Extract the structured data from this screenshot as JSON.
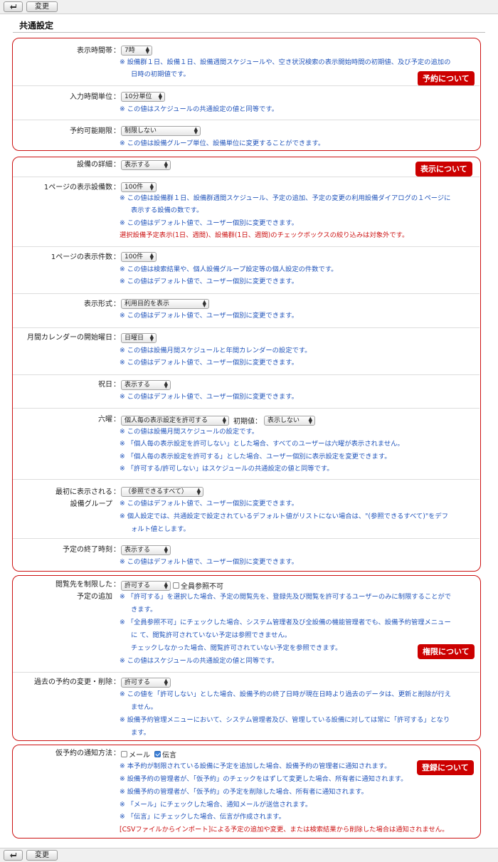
{
  "toolbar": {
    "change_label": "変更"
  },
  "page_title": "共通設定",
  "sections": {
    "yoyaku": {
      "badge": "予約について"
    },
    "hyouji": {
      "badge": "表示について"
    },
    "kengen": {
      "badge": "権限について"
    },
    "touroku": {
      "badge": "登録について"
    }
  },
  "rows": {
    "display_time": {
      "label": "表示時間帯",
      "value": "7時",
      "notes": [
        "※ 設備群１日、設備１日、設備週間スケジュールや、空き状況検索の表示開始時間の初期値、及び予定の追加の",
        "日時の初期値です。"
      ]
    },
    "input_unit": {
      "label": "入力時間単位",
      "value": "10分単位",
      "notes": [
        "※ この値はスケジュールの共通設定の値と同等です。"
      ]
    },
    "reserve_limit": {
      "label": "予約可能期限",
      "value": "制限しない",
      "notes": [
        "※ この値は設備グループ単位、設備単位に変更することができます。"
      ]
    },
    "detail": {
      "label": "設備の詳細",
      "value": "表示する"
    },
    "per_page_equipment": {
      "label": "1ページの表示設備数",
      "value": "100件",
      "notes": [
        "※ この値は設備群１日、設備群週間スケジュール、予定の追加、予定の変更の利用設備ダイアログの１ページに",
        "表示する設備の数です。",
        "※ この値はデフォルト値で、ユーザー個別に変更できます。"
      ],
      "note_red": "選択設備予定表示(1日、週間)、設備群(1日、週間)のチェックボックスの絞り込みは対象外です。"
    },
    "per_page_count": {
      "label": "1ページの表示件数",
      "value": "100件",
      "notes": [
        "※ この値は検索結果や、個人設備グループ設定等の個人設定の件数です。",
        "※ この値はデフォルト値で、ユーザー個別に変更できます。"
      ]
    },
    "display_format": {
      "label": "表示形式",
      "value": "利用目的を表示",
      "notes": [
        "※ この値はデフォルト値で、ユーザー個別に変更できます。"
      ]
    },
    "calendar_start": {
      "label": "月間カレンダーの開始曜日",
      "value": "日曜日",
      "notes": [
        "※ この値は設備月間スケジュールと年間カレンダーの設定です。",
        "※ この値はデフォルト値で、ユーザー個別に変更できます。"
      ]
    },
    "holiday": {
      "label": "祝日",
      "value": "表示する",
      "notes": [
        "※ この値はデフォルト値で、ユーザー個別に変更できます。"
      ]
    },
    "rokuyo": {
      "label": "六曜",
      "value": "個人毎の表示設定を許可する",
      "initial_label": "初期値：",
      "initial_value": "表示しない",
      "notes": [
        "※ この値は設備月間スケジュールの設定です。",
        "※ 「個人毎の表示設定を許可しない」とした場合、すべてのユーザーは六曜が表示されません。",
        "※ 「個人毎の表示設定を許可する」とした場合、ユーザー個別に表示設定を変更できます。",
        "※ 「許可する/許可しない」はスケジュールの共通設定の値と同等です。"
      ]
    },
    "first_group": {
      "label1": "最初に表示される",
      "label2": "設備グループ",
      "value": "（参照できるすべて）",
      "notes": [
        "※ この値はデフォルト値で、ユーザー個別に変更できます。",
        "※ 個人設定では、共通設定で設定されているデフォルト値がリストにない場合は、\"(参照できるすべて)\"をデフ",
        "ォルト値とします。"
      ]
    },
    "end_time": {
      "label": "予定の終了時刻",
      "value": "表示する",
      "notes": [
        "※ この値はデフォルト値で、ユーザー個別に変更できます。"
      ]
    },
    "restrict_view": {
      "label1": "閲覧先を制限した",
      "label2": "予定の追加",
      "value": "許可する",
      "checkbox_label": "全員参照不可",
      "notes": [
        "※ 「許可する」を選択した場合、予定の閲覧先を、登録先及び閲覧を許可するユーザーのみに制限することがで",
        "きます。",
        "※ 「全員参照不可」にチェックした場合、システム管理者及び全設備の機能管理者でも、設備予約管理メニュー",
        "に て、閲覧許可されていない予定は参照できません。",
        "チェックしなかった場合、閲覧許可されていない予定を参照できます。",
        "※ この値はスケジュールの共通設定の値と同等です。"
      ]
    },
    "past_change": {
      "label": "過去の予約の変更・削除",
      "value": "許可する",
      "notes": [
        "※ この値を「許可しない」とした場合、設備予約の終了日時が現在日時より過去のデータは、更新と削除が行え",
        "ません。",
        "※ 設備予約管理メニューにおいて、システム管理者及び、管理している設備に対しては常に「許可する」となり",
        "ます。"
      ]
    },
    "tentative_notify": {
      "label": "仮予約の通知方法",
      "mail_label": "メール",
      "dengon_label": "伝言",
      "notes": [
        "※ 本予約が制限されている設備に予定を追加した場合、設備予約の管理者に通知されます。",
        "※ 設備予約の管理者が、「仮予約」のチェックをはずして変更した場合、所有者に通知されます。",
        "※ 設備予約の管理者が、「仮予約」の予定を削除した場合、所有者に通知されます。",
        "※ 「メール」にチェックした場合、通知メールが送信されます。",
        "※ 「伝言」にチェックした場合、伝言が作成されます。"
      ],
      "note_red": "[CSVファイルからインポート]による予定の追加や変更、または検索結果から削除した場合は通知されません。"
    }
  },
  "colon": "："
}
